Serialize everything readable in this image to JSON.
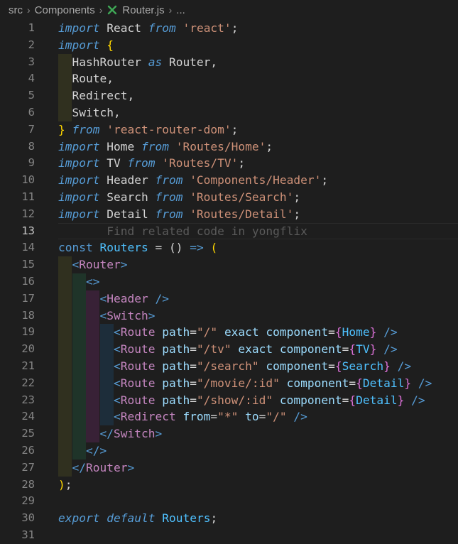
{
  "breadcrumb": {
    "items": [
      "src",
      "Components",
      "Router.js",
      "..."
    ],
    "file_icon": "react-router-icon",
    "separator": "chevron-right-icon"
  },
  "editor": {
    "active_line": 13,
    "colors": {
      "background": "#1e1e1e",
      "line_number": "#858585",
      "keyword": "#569cd6",
      "string": "#ce9178",
      "jsx_tag": "#c586c0",
      "attribute": "#9cdcfe",
      "bracket_gold": "#ffd700",
      "bracket_purple": "#da70d6",
      "bracket_blue": "#179fff"
    },
    "lines": [
      {
        "n": "1",
        "guides": [],
        "tokens": [
          [
            "kw",
            "import"
          ],
          [
            "id",
            " React "
          ],
          [
            "kw",
            "from"
          ],
          [
            "id",
            " "
          ],
          [
            "str",
            "'react'"
          ],
          [
            "id",
            ";"
          ]
        ]
      },
      {
        "n": "2",
        "guides": [],
        "tokens": [
          [
            "kw",
            "import"
          ],
          [
            "id",
            " "
          ],
          [
            "br-y",
            "{"
          ]
        ]
      },
      {
        "n": "3",
        "guides": [
          "g1"
        ],
        "tokens": [
          [
            "id",
            "  HashRouter "
          ],
          [
            "kw",
            "as"
          ],
          [
            "id",
            " Router,"
          ]
        ]
      },
      {
        "n": "4",
        "guides": [
          "g1"
        ],
        "tokens": [
          [
            "id",
            "  Route,"
          ]
        ]
      },
      {
        "n": "5",
        "guides": [
          "g1"
        ],
        "tokens": [
          [
            "id",
            "  Redirect,"
          ]
        ]
      },
      {
        "n": "6",
        "guides": [
          "g1"
        ],
        "tokens": [
          [
            "id",
            "  Switch,"
          ]
        ]
      },
      {
        "n": "7",
        "guides": [],
        "tokens": [
          [
            "br-y",
            "}"
          ],
          [
            "id",
            " "
          ],
          [
            "kw",
            "from"
          ],
          [
            "id",
            " "
          ],
          [
            "str",
            "'react-router-dom'"
          ],
          [
            "id",
            ";"
          ]
        ]
      },
      {
        "n": "8",
        "guides": [],
        "tokens": [
          [
            "kw",
            "import"
          ],
          [
            "id",
            " Home "
          ],
          [
            "kw",
            "from"
          ],
          [
            "id",
            " "
          ],
          [
            "str",
            "'Routes/Home'"
          ],
          [
            "id",
            ";"
          ]
        ]
      },
      {
        "n": "9",
        "guides": [],
        "tokens": [
          [
            "kw",
            "import"
          ],
          [
            "id",
            " TV "
          ],
          [
            "kw",
            "from"
          ],
          [
            "id",
            " "
          ],
          [
            "str",
            "'Routes/TV'"
          ],
          [
            "id",
            ";"
          ]
        ]
      },
      {
        "n": "10",
        "guides": [],
        "tokens": [
          [
            "kw",
            "import"
          ],
          [
            "id",
            " Header "
          ],
          [
            "kw",
            "from"
          ],
          [
            "id",
            " "
          ],
          [
            "str",
            "'Components/Header'"
          ],
          [
            "id",
            ";"
          ]
        ]
      },
      {
        "n": "11",
        "guides": [],
        "tokens": [
          [
            "kw",
            "import"
          ],
          [
            "id",
            " Search "
          ],
          [
            "kw",
            "from"
          ],
          [
            "id",
            " "
          ],
          [
            "str",
            "'Routes/Search'"
          ],
          [
            "id",
            ";"
          ]
        ]
      },
      {
        "n": "12",
        "guides": [],
        "tokens": [
          [
            "kw",
            "import"
          ],
          [
            "id",
            " Detail "
          ],
          [
            "kw",
            "from"
          ],
          [
            "id",
            " "
          ],
          [
            "str",
            "'Routes/Detail'"
          ],
          [
            "id",
            ";"
          ]
        ]
      },
      {
        "n": "13",
        "guides": [],
        "tokens": [
          [
            "ghost",
            "       Find related code in yongflix"
          ]
        ]
      },
      {
        "n": "14",
        "guides": [],
        "tokens": [
          [
            "kwn",
            "const"
          ],
          [
            "id",
            " "
          ],
          [
            "cls",
            "Routers"
          ],
          [
            "id",
            " = () "
          ],
          [
            "kwn",
            "=>"
          ],
          [
            "id",
            " "
          ],
          [
            "br-y",
            "("
          ]
        ]
      },
      {
        "n": "15",
        "guides": [
          "g1"
        ],
        "tokens": [
          [
            "id",
            "  "
          ],
          [
            "tagb",
            "<"
          ],
          [
            "tag",
            "Router"
          ],
          [
            "tagb",
            ">"
          ]
        ]
      },
      {
        "n": "16",
        "guides": [
          "g1",
          "g2"
        ],
        "tokens": [
          [
            "id",
            "    "
          ],
          [
            "tagb",
            "<>"
          ]
        ]
      },
      {
        "n": "17",
        "guides": [
          "g1",
          "g2",
          "g3"
        ],
        "tokens": [
          [
            "id",
            "      "
          ],
          [
            "tagb",
            "<"
          ],
          [
            "tag",
            "Header"
          ],
          [
            "id",
            " "
          ],
          [
            "tagb",
            "/>"
          ]
        ]
      },
      {
        "n": "18",
        "guides": [
          "g1",
          "g2",
          "g3"
        ],
        "tokens": [
          [
            "id",
            "      "
          ],
          [
            "tagb",
            "<"
          ],
          [
            "tag",
            "Switch"
          ],
          [
            "tagb",
            ">"
          ]
        ]
      },
      {
        "n": "19",
        "guides": [
          "g1",
          "g2",
          "g3",
          "g4"
        ],
        "tokens": [
          [
            "id",
            "        "
          ],
          [
            "tagb",
            "<"
          ],
          [
            "tag",
            "Route"
          ],
          [
            "id",
            " "
          ],
          [
            "attr",
            "path"
          ],
          [
            "id",
            "="
          ],
          [
            "str",
            "\"/\""
          ],
          [
            "id",
            " "
          ],
          [
            "attr",
            "exact"
          ],
          [
            "id",
            " "
          ],
          [
            "attr",
            "component"
          ],
          [
            "id",
            "="
          ],
          [
            "br-p",
            "{"
          ],
          [
            "cls",
            "Home"
          ],
          [
            "br-p",
            "}"
          ],
          [
            "id",
            " "
          ],
          [
            "tagb",
            "/>"
          ]
        ]
      },
      {
        "n": "20",
        "guides": [
          "g1",
          "g2",
          "g3",
          "g4"
        ],
        "tokens": [
          [
            "id",
            "        "
          ],
          [
            "tagb",
            "<"
          ],
          [
            "tag",
            "Route"
          ],
          [
            "id",
            " "
          ],
          [
            "attr",
            "path"
          ],
          [
            "id",
            "="
          ],
          [
            "str",
            "\"/tv\""
          ],
          [
            "id",
            " "
          ],
          [
            "attr",
            "exact"
          ],
          [
            "id",
            " "
          ],
          [
            "attr",
            "component"
          ],
          [
            "id",
            "="
          ],
          [
            "br-p",
            "{"
          ],
          [
            "cls",
            "TV"
          ],
          [
            "br-p",
            "}"
          ],
          [
            "id",
            " "
          ],
          [
            "tagb",
            "/>"
          ]
        ]
      },
      {
        "n": "21",
        "guides": [
          "g1",
          "g2",
          "g3",
          "g4"
        ],
        "tokens": [
          [
            "id",
            "        "
          ],
          [
            "tagb",
            "<"
          ],
          [
            "tag",
            "Route"
          ],
          [
            "id",
            " "
          ],
          [
            "attr",
            "path"
          ],
          [
            "id",
            "="
          ],
          [
            "str",
            "\"/search\""
          ],
          [
            "id",
            " "
          ],
          [
            "attr",
            "component"
          ],
          [
            "id",
            "="
          ],
          [
            "br-p",
            "{"
          ],
          [
            "cls",
            "Search"
          ],
          [
            "br-p",
            "}"
          ],
          [
            "id",
            " "
          ],
          [
            "tagb",
            "/>"
          ]
        ]
      },
      {
        "n": "22",
        "guides": [
          "g1",
          "g2",
          "g3",
          "g4"
        ],
        "tokens": [
          [
            "id",
            "        "
          ],
          [
            "tagb",
            "<"
          ],
          [
            "tag",
            "Route"
          ],
          [
            "id",
            " "
          ],
          [
            "attr",
            "path"
          ],
          [
            "id",
            "="
          ],
          [
            "str",
            "\"/movie/:id\""
          ],
          [
            "id",
            " "
          ],
          [
            "attr",
            "component"
          ],
          [
            "id",
            "="
          ],
          [
            "br-p",
            "{"
          ],
          [
            "cls",
            "Detail"
          ],
          [
            "br-p",
            "}"
          ],
          [
            "id",
            " "
          ],
          [
            "tagb",
            "/>"
          ]
        ]
      },
      {
        "n": "23",
        "guides": [
          "g1",
          "g2",
          "g3",
          "g4"
        ],
        "tokens": [
          [
            "id",
            "        "
          ],
          [
            "tagb",
            "<"
          ],
          [
            "tag",
            "Route"
          ],
          [
            "id",
            " "
          ],
          [
            "attr",
            "path"
          ],
          [
            "id",
            "="
          ],
          [
            "str",
            "\"/show/:id\""
          ],
          [
            "id",
            " "
          ],
          [
            "attr",
            "component"
          ],
          [
            "id",
            "="
          ],
          [
            "br-p",
            "{"
          ],
          [
            "cls",
            "Detail"
          ],
          [
            "br-p",
            "}"
          ],
          [
            "id",
            " "
          ],
          [
            "tagb",
            "/>"
          ]
        ]
      },
      {
        "n": "24",
        "guides": [
          "g1",
          "g2",
          "g3",
          "g4"
        ],
        "tokens": [
          [
            "id",
            "        "
          ],
          [
            "tagb",
            "<"
          ],
          [
            "tag",
            "Redirect"
          ],
          [
            "id",
            " "
          ],
          [
            "attr",
            "from"
          ],
          [
            "id",
            "="
          ],
          [
            "str",
            "\"*\""
          ],
          [
            "id",
            " "
          ],
          [
            "attr",
            "to"
          ],
          [
            "id",
            "="
          ],
          [
            "str",
            "\"/\""
          ],
          [
            "id",
            " "
          ],
          [
            "tagb",
            "/>"
          ]
        ]
      },
      {
        "n": "25",
        "guides": [
          "g1",
          "g2",
          "g3"
        ],
        "tokens": [
          [
            "id",
            "      "
          ],
          [
            "tagb",
            "</"
          ],
          [
            "tag",
            "Switch"
          ],
          [
            "tagb",
            ">"
          ]
        ]
      },
      {
        "n": "26",
        "guides": [
          "g1",
          "g2"
        ],
        "tokens": [
          [
            "id",
            "    "
          ],
          [
            "tagb",
            "</>"
          ]
        ]
      },
      {
        "n": "27",
        "guides": [
          "g1"
        ],
        "tokens": [
          [
            "id",
            "  "
          ],
          [
            "tagb",
            "</"
          ],
          [
            "tag",
            "Router"
          ],
          [
            "tagb",
            ">"
          ]
        ]
      },
      {
        "n": "28",
        "guides": [],
        "tokens": [
          [
            "br-y",
            ")"
          ],
          [
            "id",
            ";"
          ]
        ]
      },
      {
        "n": "29",
        "guides": [],
        "tokens": []
      },
      {
        "n": "30",
        "guides": [],
        "tokens": [
          [
            "kw",
            "export"
          ],
          [
            "id",
            " "
          ],
          [
            "kw",
            "default"
          ],
          [
            "id",
            " "
          ],
          [
            "cls",
            "Routers"
          ],
          [
            "id",
            ";"
          ]
        ]
      },
      {
        "n": "31",
        "guides": [],
        "tokens": []
      }
    ]
  }
}
